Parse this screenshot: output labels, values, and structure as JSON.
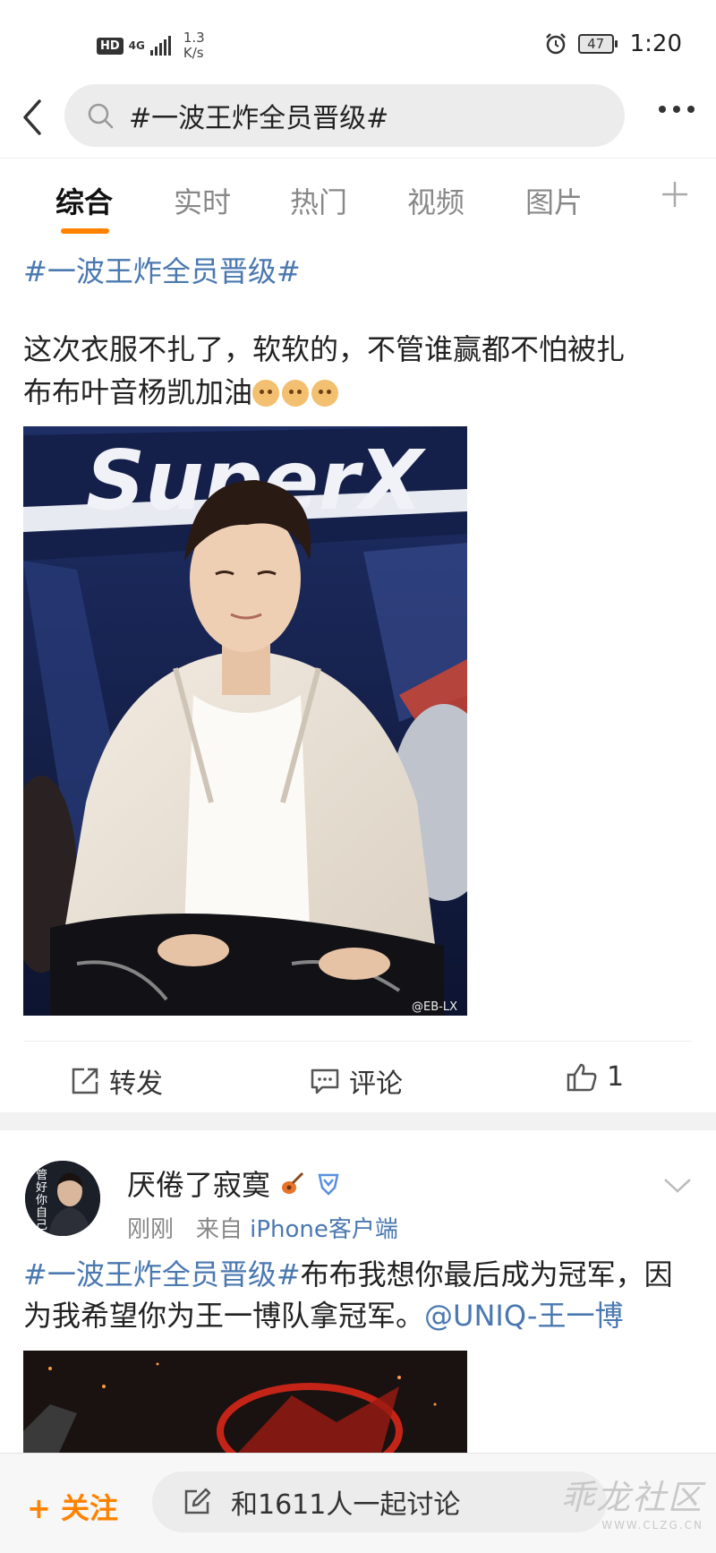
{
  "status_bar": {
    "hd": "HD",
    "network": "4G",
    "speed_value": "1.3",
    "speed_unit": "K/s",
    "battery": "47",
    "time": "1:20"
  },
  "header": {
    "search_query": "#一波王炸全员晋级#"
  },
  "tabs": [
    "综合",
    "实时",
    "热门",
    "视频",
    "图片"
  ],
  "active_tab": "综合",
  "post1": {
    "hashtag": "#一波王炸全员晋级#",
    "text_line1": "这次衣服不扎了，软软的，不管谁赢都不怕被扎",
    "text_line2": "布布叶音杨凯加油",
    "emoji_count": 3,
    "image_banner": "SuperX",
    "image_watermark": "@EB-LX",
    "actions": {
      "repost": "转发",
      "comment": "评论",
      "like_count": "1"
    }
  },
  "post2": {
    "avatar_text": "管好你自己",
    "username": "厌倦了寂寞",
    "time": "刚刚",
    "source_prefix": "来自",
    "source": "iPhone客户端",
    "hashtag": "#一波王炸全员晋级#",
    "text": "布布我想你最后成为冠军，因为我希望你为王一博队拿冠军。",
    "mention": "@UNIQ-王一博"
  },
  "bottom_bar": {
    "follow": "关注",
    "discuss": "和1611人一起讨论",
    "watermark_main": "乖龙社区",
    "watermark_sub": "WWW.CLZG.CN"
  },
  "colors": {
    "accent": "#ff8200",
    "link": "#4a78b0"
  }
}
